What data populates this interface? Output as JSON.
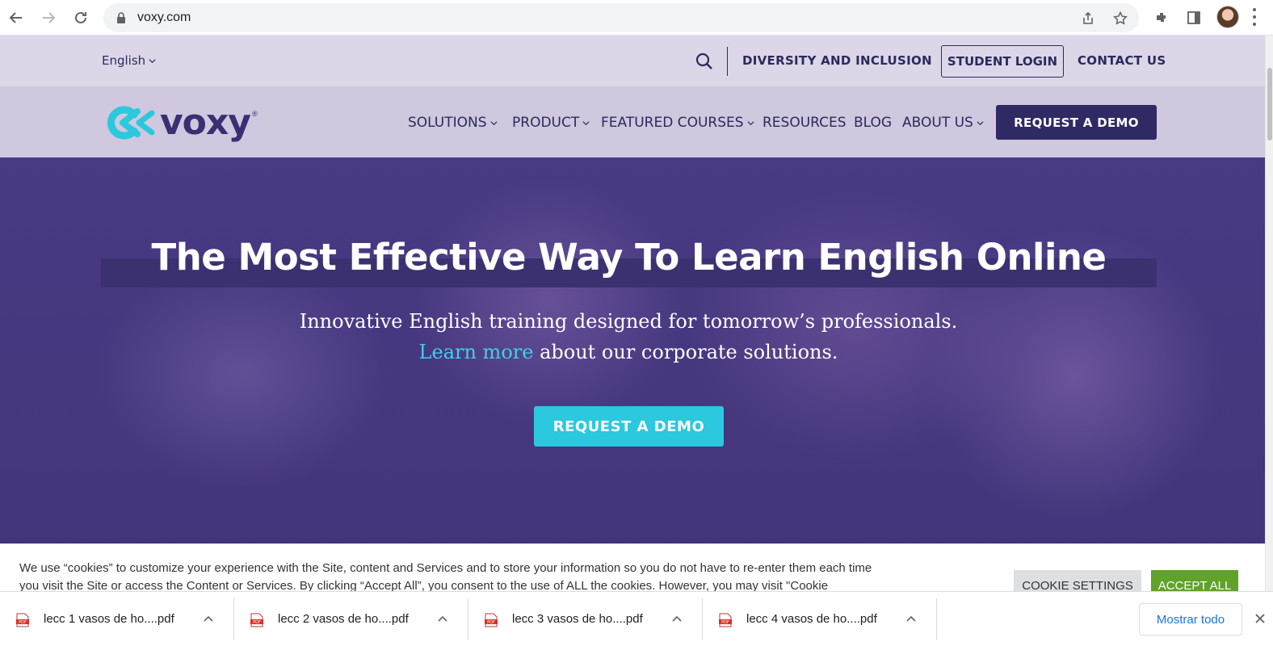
{
  "browser": {
    "url": "voxy.com",
    "icons": [
      "back-icon",
      "forward-icon",
      "reload-icon",
      "lock-icon",
      "share-icon",
      "star-icon",
      "extensions-icon",
      "side-panel-icon",
      "avatar",
      "menu-icon"
    ]
  },
  "topbar": {
    "language": "English",
    "links": {
      "diversity": "DIVERSITY AND INCLUSION",
      "student_login": "STUDENT LOGIN",
      "contact": "CONTACT US"
    }
  },
  "nav": {
    "logo_text": "voxy",
    "logo_reg": "®",
    "items": [
      {
        "label": "SOLUTIONS"
      },
      {
        "label": "PRODUCT"
      },
      {
        "label": "FEATURED COURSES"
      },
      {
        "label": "RESOURCES"
      },
      {
        "label": "BLOG"
      },
      {
        "label": "ABOUT US"
      }
    ],
    "cta": "REQUEST A DEMO"
  },
  "hero": {
    "headline": "The Most Effective Way To Learn English Online",
    "subtitle": "Innovative English training designed for tomorrow’s professionals.",
    "link_text": "Learn more",
    "link_rest": " about our corporate solutions.",
    "cta": "REQUEST A DEMO"
  },
  "cookie": {
    "text": "We use “cookies” to customize your experience with the Site, content and Services and to store your information so you do not have to re-enter them each time you visit the Site or access the Content or Services. By clicking “Accept All”, you consent to the use of ALL the cookies. However, you may visit \"Cookie Settings\" to provide a controlled consent.",
    "settings_label": "COOKIE SETTINGS",
    "accept_label": "ACCEPT ALL"
  },
  "downloads": {
    "files": [
      {
        "name": "lecc 1 vasos de ho....pdf"
      },
      {
        "name": "lecc 2 vasos de ho....pdf"
      },
      {
        "name": "lecc 3 vasos de ho....pdf"
      },
      {
        "name": "lecc 4 vasos de ho....pdf"
      }
    ],
    "show_all": "Mostrar todo",
    "pdf_badge": "PDF"
  },
  "colors": {
    "brand_navy": "#2f2964",
    "brand_cyan": "#2bc8de",
    "accept_green": "#61a229"
  }
}
